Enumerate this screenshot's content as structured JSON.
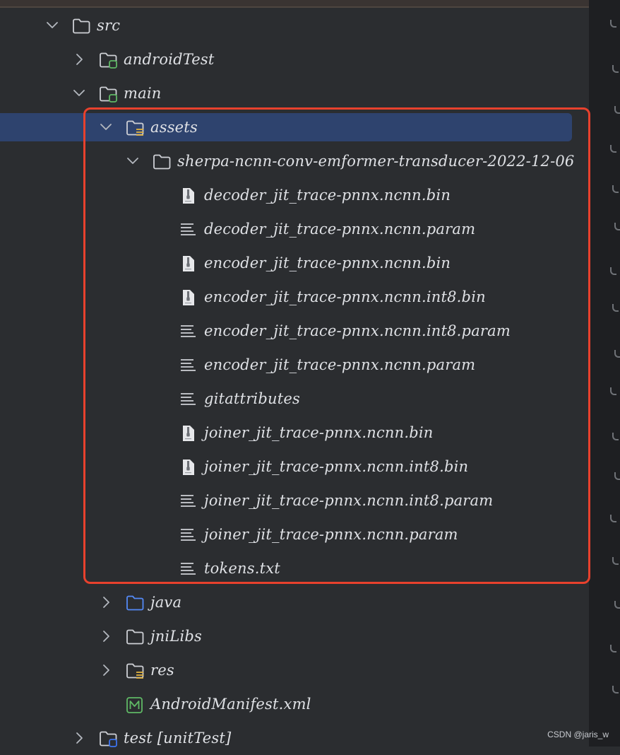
{
  "tree": {
    "rows": [
      {
        "key": "src",
        "label": "src",
        "depth": 0,
        "expander": "expanded",
        "icon": "folder-icon"
      },
      {
        "key": "androidTest",
        "label": "androidTest",
        "depth": 1,
        "expander": "collapsed",
        "icon": "test-folder-icon"
      },
      {
        "key": "main",
        "label": "main",
        "depth": 1,
        "expander": "expanded",
        "icon": "source-set-folder-icon"
      },
      {
        "key": "assets",
        "label": "assets",
        "depth": 2,
        "expander": "expanded",
        "icon": "resource-folder-icon",
        "selected": true
      },
      {
        "key": "sherpa",
        "label": "sherpa-ncnn-conv-emformer-transducer-2022-12-06",
        "depth": 3,
        "expander": "expanded",
        "icon": "folder-icon"
      },
      {
        "key": "f1",
        "label": "decoder_jit_trace-pnnx.ncnn.bin",
        "depth": 4,
        "expander": "none",
        "icon": "binary-file-icon"
      },
      {
        "key": "f2",
        "label": "decoder_jit_trace-pnnx.ncnn.param",
        "depth": 4,
        "expander": "none",
        "icon": "text-file-icon"
      },
      {
        "key": "f3",
        "label": "encoder_jit_trace-pnnx.ncnn.bin",
        "depth": 4,
        "expander": "none",
        "icon": "binary-file-icon"
      },
      {
        "key": "f4",
        "label": "encoder_jit_trace-pnnx.ncnn.int8.bin",
        "depth": 4,
        "expander": "none",
        "icon": "binary-file-icon"
      },
      {
        "key": "f5",
        "label": "encoder_jit_trace-pnnx.ncnn.int8.param",
        "depth": 4,
        "expander": "none",
        "icon": "text-file-icon"
      },
      {
        "key": "f6",
        "label": "encoder_jit_trace-pnnx.ncnn.param",
        "depth": 4,
        "expander": "none",
        "icon": "text-file-icon"
      },
      {
        "key": "f7",
        "label": "gitattributes",
        "depth": 4,
        "expander": "none",
        "icon": "text-file-icon"
      },
      {
        "key": "f8",
        "label": "joiner_jit_trace-pnnx.ncnn.bin",
        "depth": 4,
        "expander": "none",
        "icon": "binary-file-icon"
      },
      {
        "key": "f9",
        "label": "joiner_jit_trace-pnnx.ncnn.int8.bin",
        "depth": 4,
        "expander": "none",
        "icon": "binary-file-icon"
      },
      {
        "key": "f10",
        "label": "joiner_jit_trace-pnnx.ncnn.int8.param",
        "depth": 4,
        "expander": "none",
        "icon": "text-file-icon"
      },
      {
        "key": "f11",
        "label": "joiner_jit_trace-pnnx.ncnn.param",
        "depth": 4,
        "expander": "none",
        "icon": "text-file-icon"
      },
      {
        "key": "f12",
        "label": "tokens.txt",
        "depth": 4,
        "expander": "none",
        "icon": "text-file-icon"
      },
      {
        "key": "java",
        "label": "java",
        "depth": 2,
        "expander": "collapsed",
        "icon": "source-folder-icon"
      },
      {
        "key": "jniLibs",
        "label": "jniLibs",
        "depth": 2,
        "expander": "collapsed",
        "icon": "folder-icon"
      },
      {
        "key": "res",
        "label": "res",
        "depth": 2,
        "expander": "collapsed",
        "icon": "resource-folder-icon"
      },
      {
        "key": "manifest",
        "label": "AndroidManifest.xml",
        "depth": 2,
        "expander": "none",
        "icon": "manifest-file-icon"
      },
      {
        "key": "test",
        "label": "test [unitTest]",
        "depth": 1,
        "expander": "collapsed",
        "icon": "unit-test-folder-icon"
      }
    ]
  },
  "colors": {
    "background": "#2b2d30",
    "selection": "#2e436e",
    "highlight_border": "#e8412d",
    "text": "#dfe1e5",
    "test_badge": "#5fb865",
    "resource_badge": "#e3b341",
    "source_folder": "#548af7",
    "unit_test_badge": "#3d74f0"
  },
  "watermark": "CSDN @jaris_w"
}
